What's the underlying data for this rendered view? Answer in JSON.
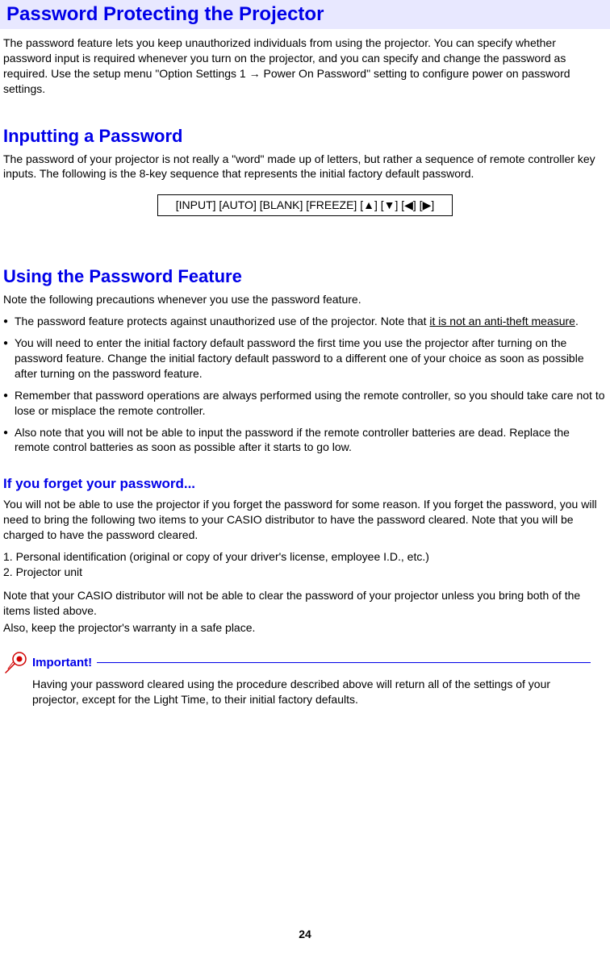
{
  "title": "Password Protecting the Projector",
  "intro": "The password feature lets you keep unauthorized individuals from using the projector. You can specify whether password input is required whenever you turn on the projector, and you can specify and change the password as required. Use the setup menu \"Option Settings 1 → Power On Password\" setting to configure power on password settings.",
  "section1": {
    "heading": "Inputting a Password",
    "text": "The password of your projector is not really a \"word\" made up of letters, but rather a sequence of remote controller key inputs. The following is the 8-key sequence that represents the initial factory default password.",
    "password_sequence": "[INPUT] [AUTO] [BLANK] [FREEZE] [▲] [▼] [◀] [▶]"
  },
  "section2": {
    "heading": "Using the Password Feature",
    "intro": "Note the following precautions whenever you use the password feature.",
    "bullets": {
      "b1_part1": "The password feature protects against unauthorized use of the projector. Note that ",
      "b1_underline": "it is not an anti-theft measure",
      "b1_part2": ".",
      "b2": "You will need to enter the initial factory default password the first time you use the projector after turning on the password feature. Change the initial factory default password to a different one of your choice as soon as possible after turning on the password feature.",
      "b3": "Remember that password operations are always performed using the remote controller, so you should take care not to lose or misplace the remote controller.",
      "b4": "Also note that you will not be able to input the password if the remote controller batteries are dead. Replace the remote control batteries as soon as possible after it starts to go low."
    }
  },
  "section3": {
    "heading": "If you forget your password...",
    "text1": "You will not be able to use the projector if you forget the password for some reason. If you forget the password, you will need to bring the following two items to your CASIO distributor to have the password cleared. Note that you will be charged to have the password cleared.",
    "item1": "1. Personal identification (original or copy of your driver's license, employee I.D., etc.)",
    "item2": "2. Projector unit",
    "text2": "Note that your CASIO distributor will not be able to clear the password of your projector unless you bring both of the items listed above.",
    "text3": "Also, keep the projector's warranty in a safe place."
  },
  "important": {
    "label": "Important!",
    "text": "Having your password cleared using the procedure described above will return all of the settings of your projector, except for the Light Time, to their initial factory defaults."
  },
  "page_number": "24"
}
